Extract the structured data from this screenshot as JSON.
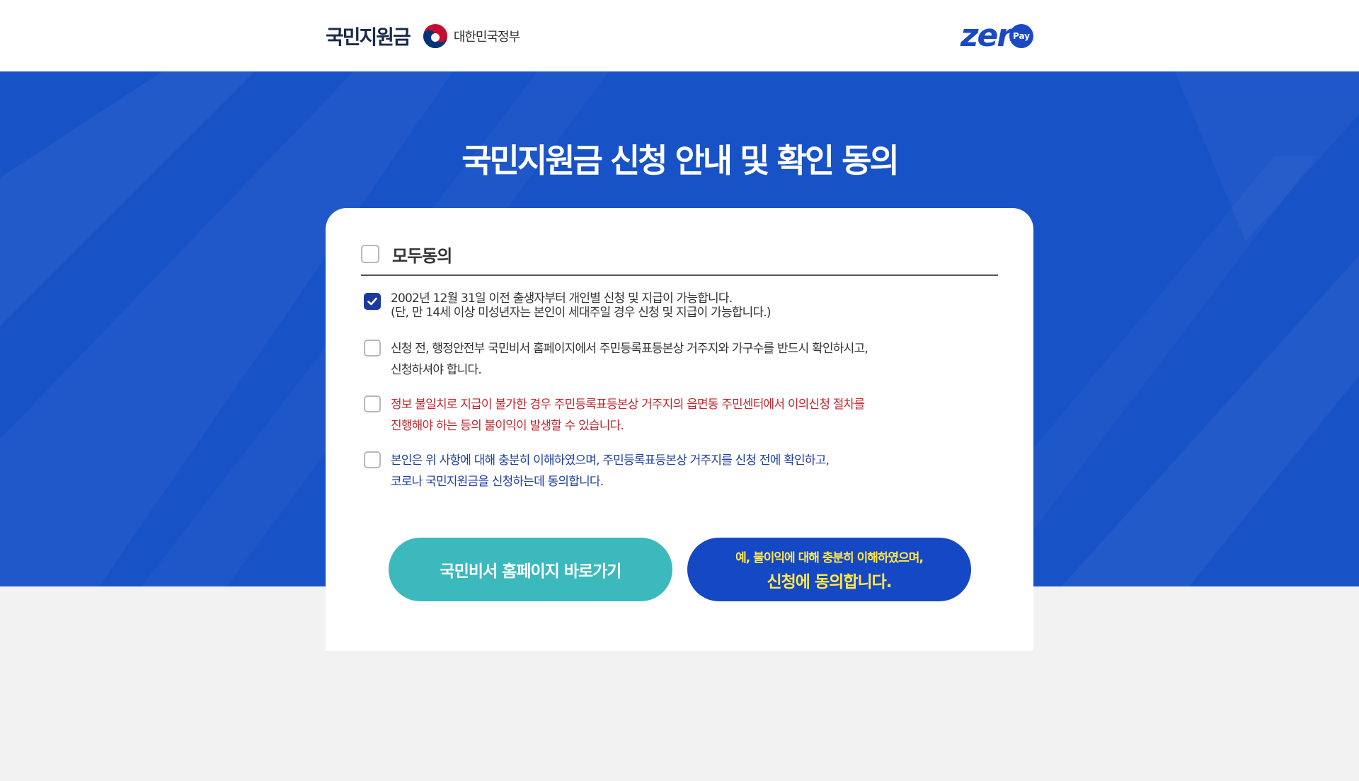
{
  "header": {
    "brand_title": "국민지원금",
    "gov_name": "대한민국정부",
    "partner_logo": {
      "text": "zer",
      "badge": "Pay"
    }
  },
  "hero": {
    "title": "국민지원금 신청 안내 및 확인 동의",
    "background_color": "#1752c7"
  },
  "form": {
    "agree_all": {
      "label": "모두동의",
      "checked": false
    },
    "items": [
      {
        "checked": true,
        "tone": "default",
        "lines": [
          "2002년 12월 31일 이전 출생자부터 개인별 신청 및 지급이 가능합니다.",
          "(단, 만 14세 이상 미성년자는 본인이 세대주일 경우 신청 및 지급이 가능합니다.)"
        ]
      },
      {
        "checked": false,
        "tone": "default",
        "lines": [
          "신청 전, 행정안전부 국민비서 홈페이지에서 주민등록표등본상 거주지와 가구수를 반드시 확인하시고,",
          "신청하셔야 합니다."
        ]
      },
      {
        "checked": false,
        "tone": "red",
        "lines": [
          "정보 불일치로 지급이 불가한 경우 주민등록표등본상 거주지의 읍면동 주민센터에서 이의신청 절차를",
          "진행해야 하는 등의 불이익이 발생할 수 있습니다."
        ]
      },
      {
        "checked": false,
        "tone": "blue",
        "lines": [
          "본인은 위 사항에 대해 충분히 이해하였으며, 주민등록표등본상 거주지를 신청 전에 확인하고,",
          "코로나 국민지원금을 신청하는데 동의합니다."
        ]
      }
    ]
  },
  "buttons": {
    "homepage": "국민비서 홈페이지 바로가기",
    "agree_line1": "예, 불이익에 대해 충분히 이해하였으며,",
    "agree_line2": "신청에 동의합니다."
  },
  "colors": {
    "primary_blue": "#1548c4",
    "teal": "#3bb9bd",
    "highlight_yellow": "#ffe84a",
    "warning_red": "#c0272d",
    "notice_blue": "#1f3fa0"
  }
}
